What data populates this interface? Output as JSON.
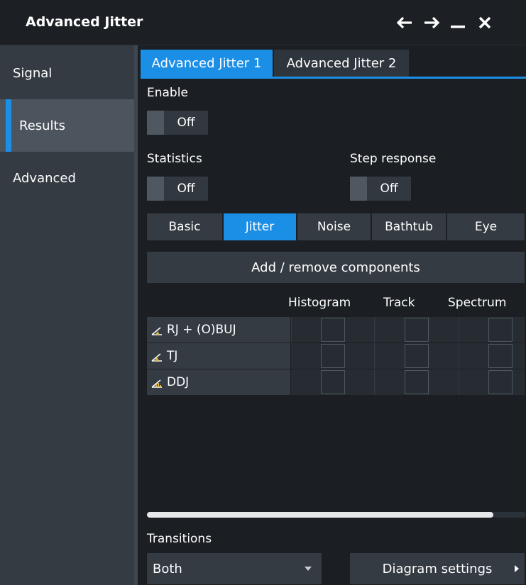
{
  "window": {
    "title": "Advanced Jitter"
  },
  "sidebar": {
    "items": [
      {
        "label": "Signal"
      },
      {
        "label": "Results"
      },
      {
        "label": "Advanced"
      }
    ],
    "active_index": 1
  },
  "tabs": [
    {
      "label": "Advanced Jitter 1"
    },
    {
      "label": "Advanced Jitter 2"
    }
  ],
  "enable": {
    "label": "Enable",
    "value": "Off"
  },
  "statistics": {
    "label": "Statistics",
    "value": "Off"
  },
  "step_response": {
    "label": "Step response",
    "value": "Off"
  },
  "subtabs": [
    {
      "label": "Basic"
    },
    {
      "label": "Jitter"
    },
    {
      "label": "Noise"
    },
    {
      "label": "Bathtub"
    },
    {
      "label": "Eye"
    }
  ],
  "add_remove_label": "Add / remove components",
  "columns": [
    "Histogram",
    "Track",
    "Spectrum"
  ],
  "rows": [
    {
      "label": "RJ + (O)BUJ",
      "icon": "rj-jitter-icon"
    },
    {
      "label": "TJ",
      "icon": "tj-jitter-icon"
    },
    {
      "label": "DDJ",
      "icon": "ddj-jitter-icon"
    }
  ],
  "transitions": {
    "label": "Transitions",
    "value": "Both"
  },
  "diagram_settings_label": "Diagram settings",
  "colors": {
    "accent": "#1b8ee6",
    "panel": "#343b43",
    "background": "#1b1f23"
  }
}
